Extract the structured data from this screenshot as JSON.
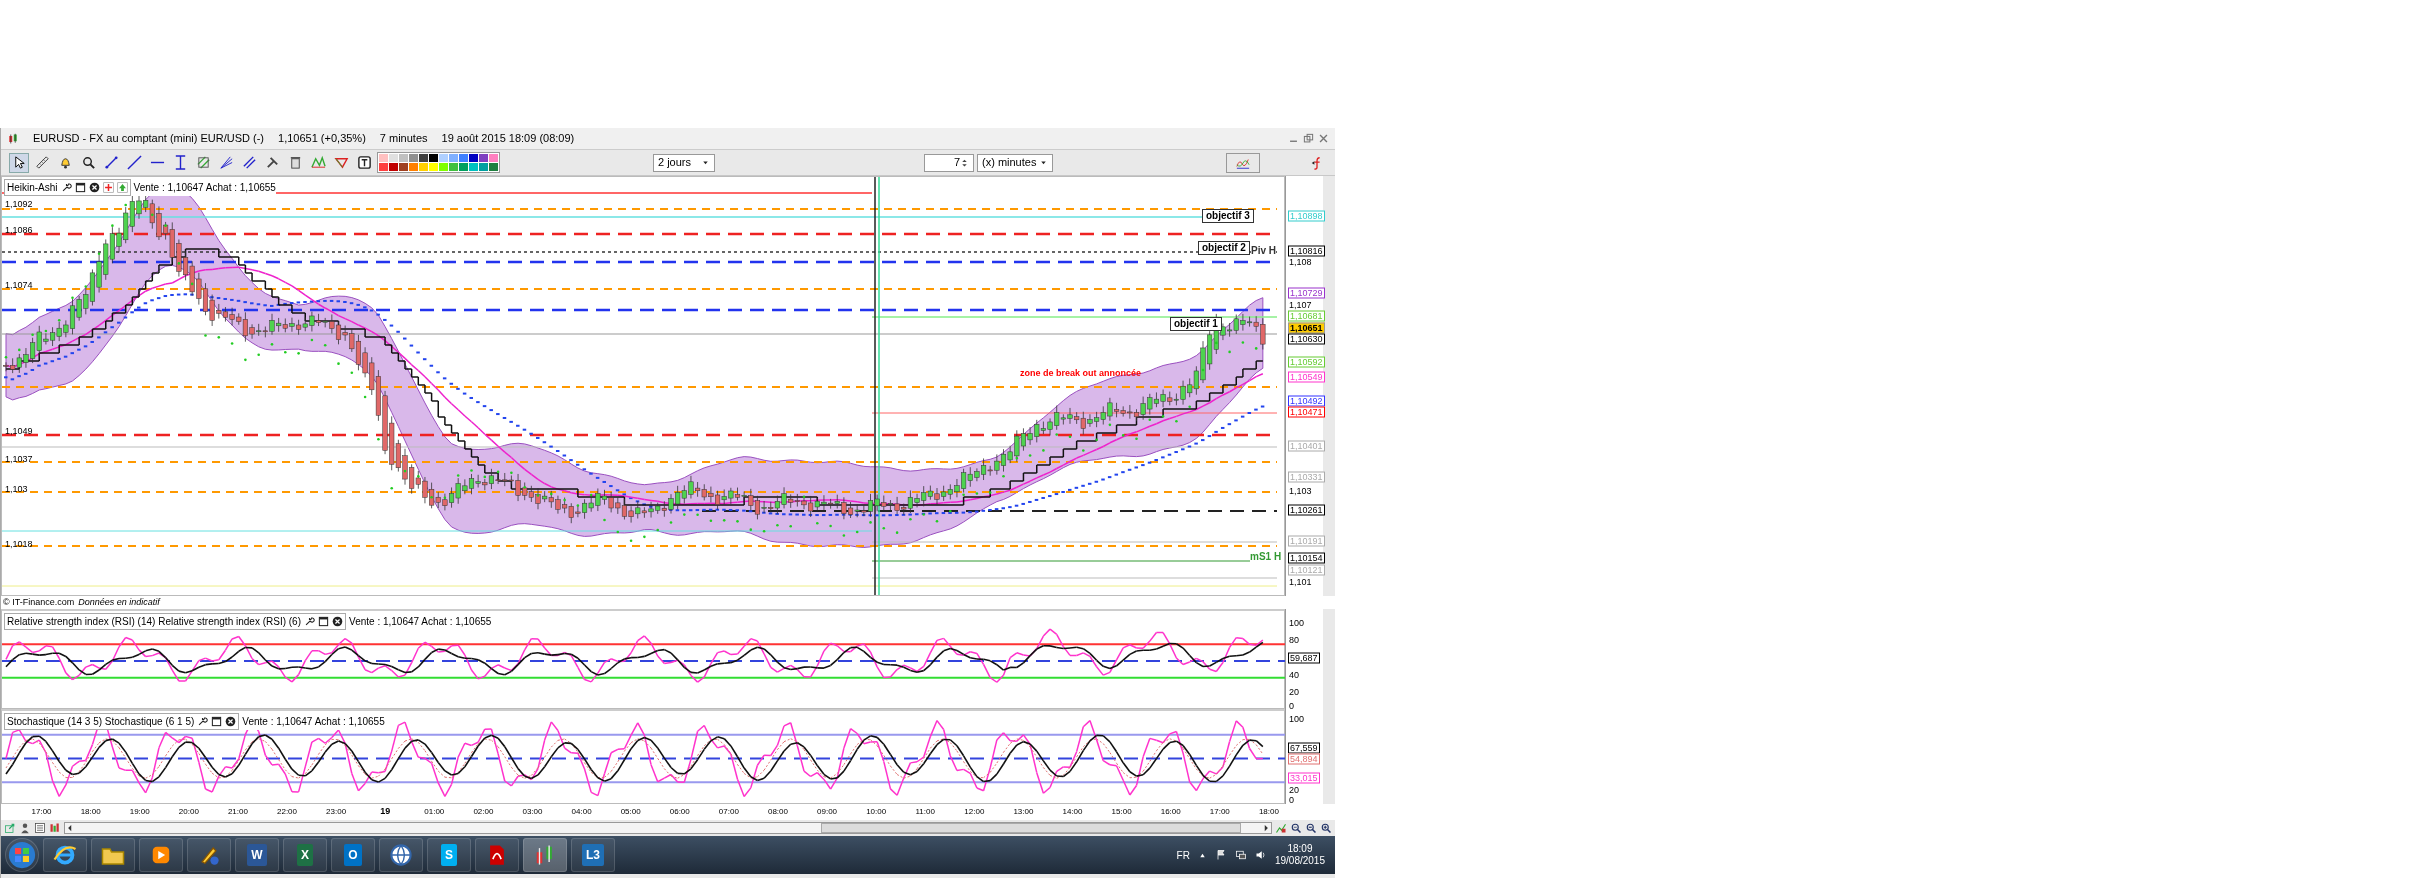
{
  "window": {
    "title": "EURUSD - FX au comptant (mini) EUR/USD (-)",
    "price": "1,10651 (+0,35%)",
    "period": "7 minutes",
    "datetime": "19 août 2015 18:09 (08:09)"
  },
  "toolbar": {
    "range": "2 jours",
    "interval_value": "7",
    "interval_unit": "(x) minutes"
  },
  "price_panel": {
    "chart_type": "Heikin-Ashi",
    "quote": "Vente : 1,10647 Achat : 1,10655",
    "left_labels": [
      "1,1092",
      "1,1086",
      "1,1074",
      "1,1049",
      "1,1037",
      "1,103",
      "1,1018"
    ],
    "axis_labels": [
      {
        "text": "1,10898",
        "kind": "tag",
        "color": "#33cccc"
      },
      {
        "text": "1,10816",
        "kind": "tag",
        "color": "#000000"
      },
      {
        "text": "1,108",
        "kind": "tick"
      },
      {
        "text": "1,10729",
        "kind": "tag",
        "color": "#9933cc"
      },
      {
        "text": "1,107",
        "kind": "tick"
      },
      {
        "text": "1,10681",
        "kind": "tag",
        "color": "#66cc33"
      },
      {
        "text": "1,10651",
        "kind": "current",
        "color": "#ffcc00"
      },
      {
        "text": "1,10630",
        "kind": "tag",
        "color": "#000000"
      },
      {
        "text": "1,10592",
        "kind": "tag",
        "color": "#66cc33"
      },
      {
        "text": "1,10549",
        "kind": "tag",
        "color": "#ff33cc"
      },
      {
        "text": "1,10492",
        "kind": "tag",
        "color": "#3333ff"
      },
      {
        "text": "1,10471",
        "kind": "tag",
        "color": "#ff0000"
      },
      {
        "text": "1,10401",
        "kind": "tag",
        "color": "#aaaaaa"
      },
      {
        "text": "1,10331",
        "kind": "tag",
        "color": "#aaaaaa"
      },
      {
        "text": "1,103",
        "kind": "tick"
      },
      {
        "text": "1,10261",
        "kind": "tag",
        "color": "#000000"
      },
      {
        "text": "1,10191",
        "kind": "tag",
        "color": "#aaaaaa"
      },
      {
        "text": "1,10154",
        "kind": "tag",
        "color": "#000000"
      },
      {
        "text": "1,10121",
        "kind": "tag",
        "color": "#aaaaaa"
      },
      {
        "text": "1,101",
        "kind": "tick"
      }
    ],
    "annotations": [
      {
        "text": "objectif 3",
        "kind": "box"
      },
      {
        "text": "objectif 2",
        "kind": "box"
      },
      {
        "text": "Piv H",
        "kind": "tag",
        "color": "#333333"
      },
      {
        "text": "objectif 1",
        "kind": "box"
      },
      {
        "text": "zone de break out annoncée",
        "kind": "note"
      },
      {
        "text": "mS1 H",
        "kind": "tag",
        "color": "#339933"
      }
    ],
    "credit": "© IT-Finance.com",
    "disclaimer": "Données en indicatif"
  },
  "rsi_panel": {
    "title": "Relative strength index (RSI) (14) Relative strength index (RSI) (6)",
    "quote": "Vente : 1,10647 Achat : 1,10655",
    "axis_labels": [
      {
        "text": "100",
        "kind": "tick"
      },
      {
        "text": "80",
        "kind": "tick"
      },
      {
        "text": "59,687",
        "kind": "tag",
        "color": "#000000"
      },
      {
        "text": "40",
        "kind": "tick"
      },
      {
        "text": "20",
        "kind": "tick"
      },
      {
        "text": "0",
        "kind": "tick"
      }
    ]
  },
  "stoch_panel": {
    "title": "Stochastique (14 3 5) Stochastique (6 1 5)",
    "quote": "Vente : 1,10647 Achat : 1,10655",
    "axis_labels": [
      {
        "text": "100",
        "kind": "tick"
      },
      {
        "text": "67,559",
        "kind": "tag",
        "color": "#000000"
      },
      {
        "text": "54,894",
        "kind": "tag",
        "color": "#e07070"
      },
      {
        "text": "33,015",
        "kind": "tag",
        "color": "#ff33cc"
      },
      {
        "text": "20",
        "kind": "tick"
      },
      {
        "text": "0",
        "kind": "tick"
      }
    ]
  },
  "time_axis": [
    {
      "text": "17:00",
      "kind": "hour"
    },
    {
      "text": "18:00",
      "kind": "hour"
    },
    {
      "text": "19:00",
      "kind": "hour"
    },
    {
      "text": "20:00",
      "kind": "hour"
    },
    {
      "text": "21:00",
      "kind": "hour"
    },
    {
      "text": "22:00",
      "kind": "hour"
    },
    {
      "text": "23:00",
      "kind": "hour"
    },
    {
      "text": "19",
      "kind": "day"
    },
    {
      "text": "01:00",
      "kind": "hour"
    },
    {
      "text": "02:00",
      "kind": "hour"
    },
    {
      "text": "03:00",
      "kind": "hour"
    },
    {
      "text": "04:00",
      "kind": "hour"
    },
    {
      "text": "05:00",
      "kind": "hour"
    },
    {
      "text": "06:00",
      "kind": "hour"
    },
    {
      "text": "07:00",
      "kind": "hour"
    },
    {
      "text": "08:00",
      "kind": "hour"
    },
    {
      "text": "09:00",
      "kind": "hour"
    },
    {
      "text": "10:00",
      "kind": "hour"
    },
    {
      "text": "11:00",
      "kind": "hour"
    },
    {
      "text": "12:00",
      "kind": "hour"
    },
    {
      "text": "13:00",
      "kind": "hour"
    },
    {
      "text": "14:00",
      "kind": "hour"
    },
    {
      "text": "15:00",
      "kind": "hour"
    },
    {
      "text": "16:00",
      "kind": "hour"
    },
    {
      "text": "17:00",
      "kind": "hour"
    },
    {
      "text": "18:00",
      "kind": "hour"
    }
  ],
  "taskbar": {
    "apps": [
      {
        "kind": "start"
      },
      {
        "kind": "browser"
      },
      {
        "kind": "folder"
      },
      {
        "kind": "media"
      },
      {
        "kind": "paint"
      },
      {
        "kind": "tile",
        "label": "W",
        "color": "#2b5797"
      },
      {
        "kind": "tile",
        "label": "X",
        "color": "#1e7145"
      },
      {
        "kind": "tile",
        "label": "O",
        "color": "#0072c6"
      },
      {
        "kind": "globe"
      },
      {
        "kind": "tile",
        "label": "S",
        "color": "#00aff0"
      },
      {
        "kind": "pdf"
      },
      {
        "kind": "chart"
      },
      {
        "kind": "tile",
        "label": "L3",
        "color": "#1f6fb5"
      }
    ],
    "language": "FR",
    "time": "18:09",
    "date": "19/08/2015"
  }
}
